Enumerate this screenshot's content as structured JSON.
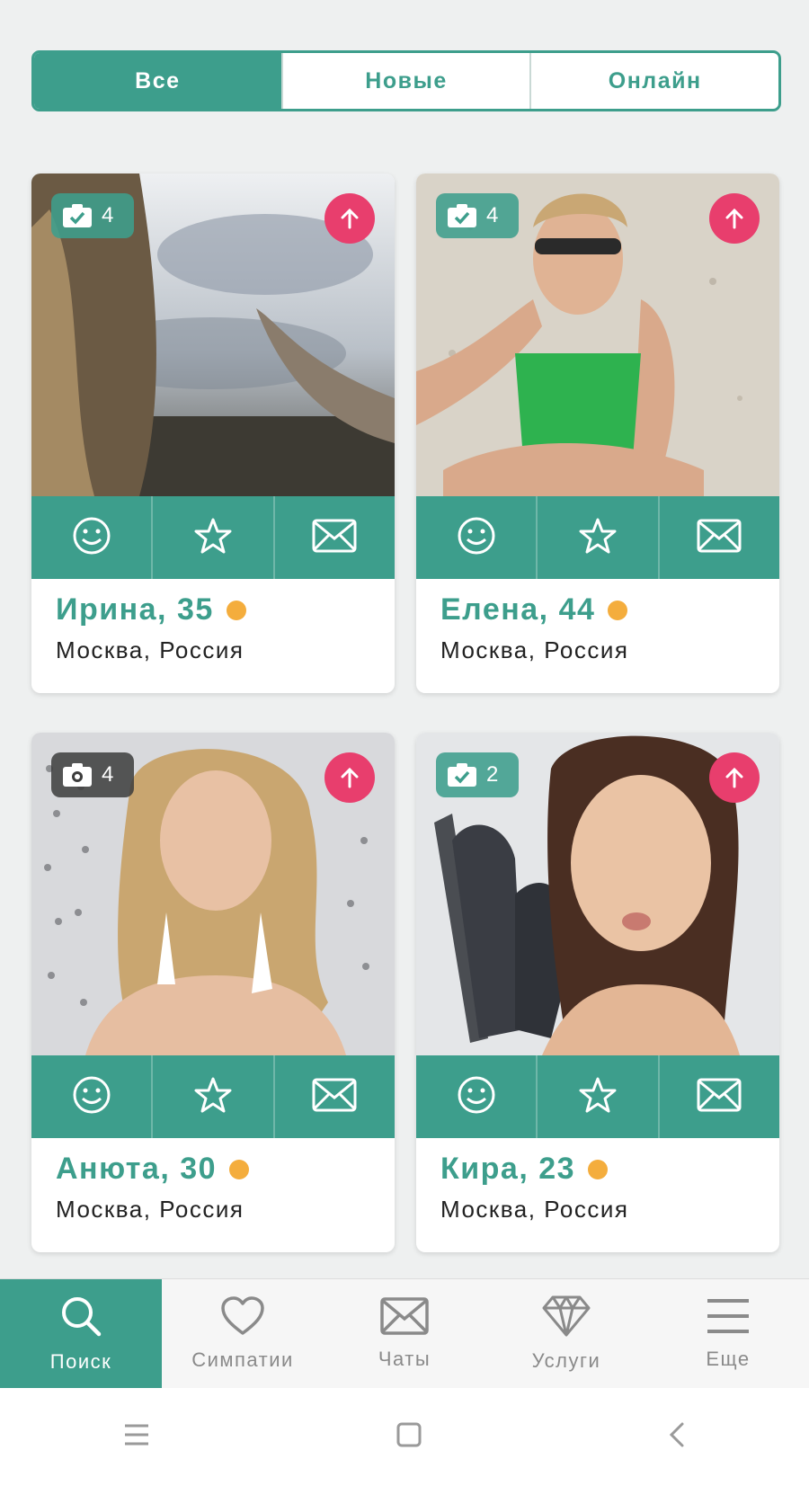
{
  "tabs": [
    {
      "label": "Все",
      "active": true
    },
    {
      "label": "Новые",
      "active": false
    },
    {
      "label": "Онлайн",
      "active": false
    }
  ],
  "profiles": [
    {
      "name": "Ирина, 35",
      "city": "Москва, Россия",
      "photo_count": "4",
      "photo_badge_icon": "camera-check-icon",
      "online": true
    },
    {
      "name": "Елена, 44",
      "city": "Москва, Россия",
      "photo_count": "4",
      "photo_badge_icon": "camera-check-icon",
      "online": true
    },
    {
      "name": "Анюта, 30",
      "city": "Москва, Россия",
      "photo_count": "4",
      "photo_badge_icon": "camera-icon",
      "online": true
    },
    {
      "name": "Кира, 23",
      "city": "Москва, Россия",
      "photo_count": "2",
      "photo_badge_icon": "camera-check-icon",
      "online": true
    }
  ],
  "card_actions": [
    "smile-icon",
    "star-icon",
    "envelope-icon"
  ],
  "bottom_nav": [
    {
      "label": "Поиск",
      "icon": "search-icon",
      "active": true
    },
    {
      "label": "Симпатии",
      "icon": "heart-icon",
      "active": false
    },
    {
      "label": "Чаты",
      "icon": "envelope-icon",
      "active": false
    },
    {
      "label": "Услуги",
      "icon": "diamond-icon",
      "active": false
    },
    {
      "label": "Еще",
      "icon": "menu-icon",
      "active": false
    }
  ],
  "system_nav": [
    "recents-icon",
    "home-icon",
    "back-icon"
  ],
  "colors": {
    "accent": "#3d9e8c",
    "boost": "#e83e6d",
    "online_dot": "#f4ad3d"
  }
}
